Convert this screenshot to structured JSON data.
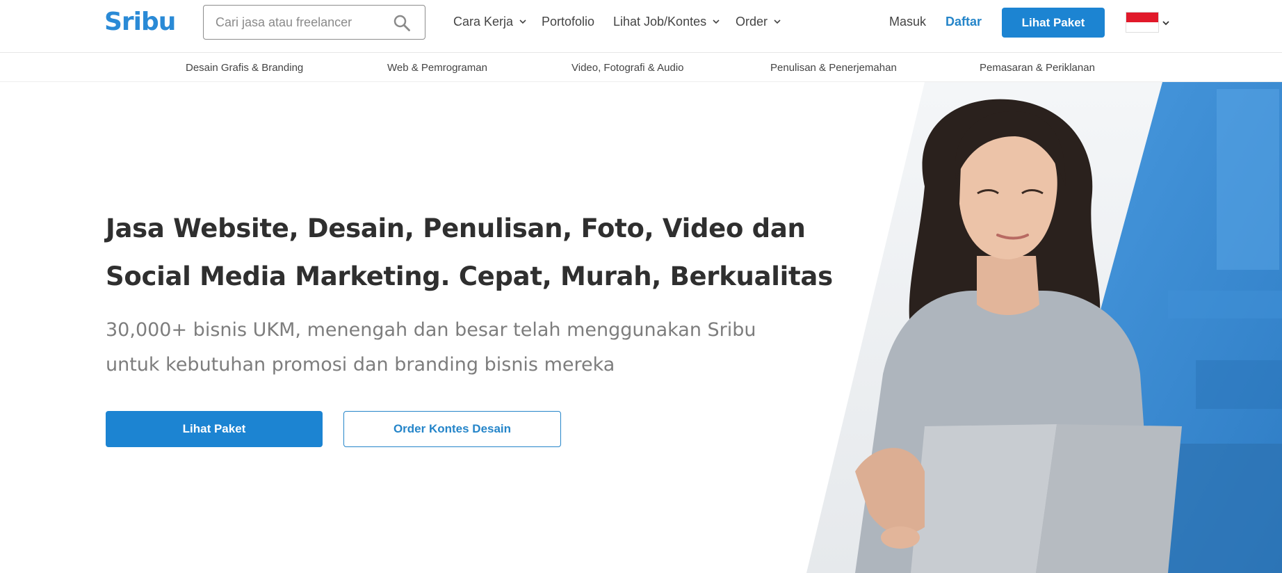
{
  "brand": {
    "logo_text": "Sribu",
    "color": "#2a8ad6"
  },
  "search": {
    "placeholder": "Cari jasa atau freelancer",
    "icon": "search-icon"
  },
  "nav": {
    "items": [
      {
        "label": "Cara Kerja",
        "has_dropdown": true
      },
      {
        "label": "Portofolio",
        "has_dropdown": false
      },
      {
        "label": "Lihat Job/Kontes",
        "has_dropdown": true
      },
      {
        "label": "Order",
        "has_dropdown": true
      }
    ],
    "login": "Masuk",
    "register": "Daftar",
    "cta": "Lihat Paket",
    "language_flag": "indonesia-flag-icon"
  },
  "categories": [
    "Desain Grafis & Branding",
    "Web & Pemrograman",
    "Video, Fotografi & Audio",
    "Penulisan & Penerjemahan",
    "Pemasaran & Periklanan"
  ],
  "hero": {
    "headline_line1": "Jasa Website, Desain, Penulisan, Foto, Video dan",
    "headline_line2": "Social Media Marketing. Cepat, Murah, Berkualitas",
    "sub_line1": "30,000+ bisnis UKM, menengah dan besar telah menggunakan Sribu",
    "sub_line2": "untuk kebutuhan promosi dan branding bisnis mereka",
    "primary_button": "Lihat Paket",
    "secondary_button": "Order Kontes Desain"
  },
  "colors": {
    "accent": "#1c84d2",
    "link": "#2585c9",
    "headline": "#2f2f2f",
    "subtext": "#7d7d7d"
  }
}
